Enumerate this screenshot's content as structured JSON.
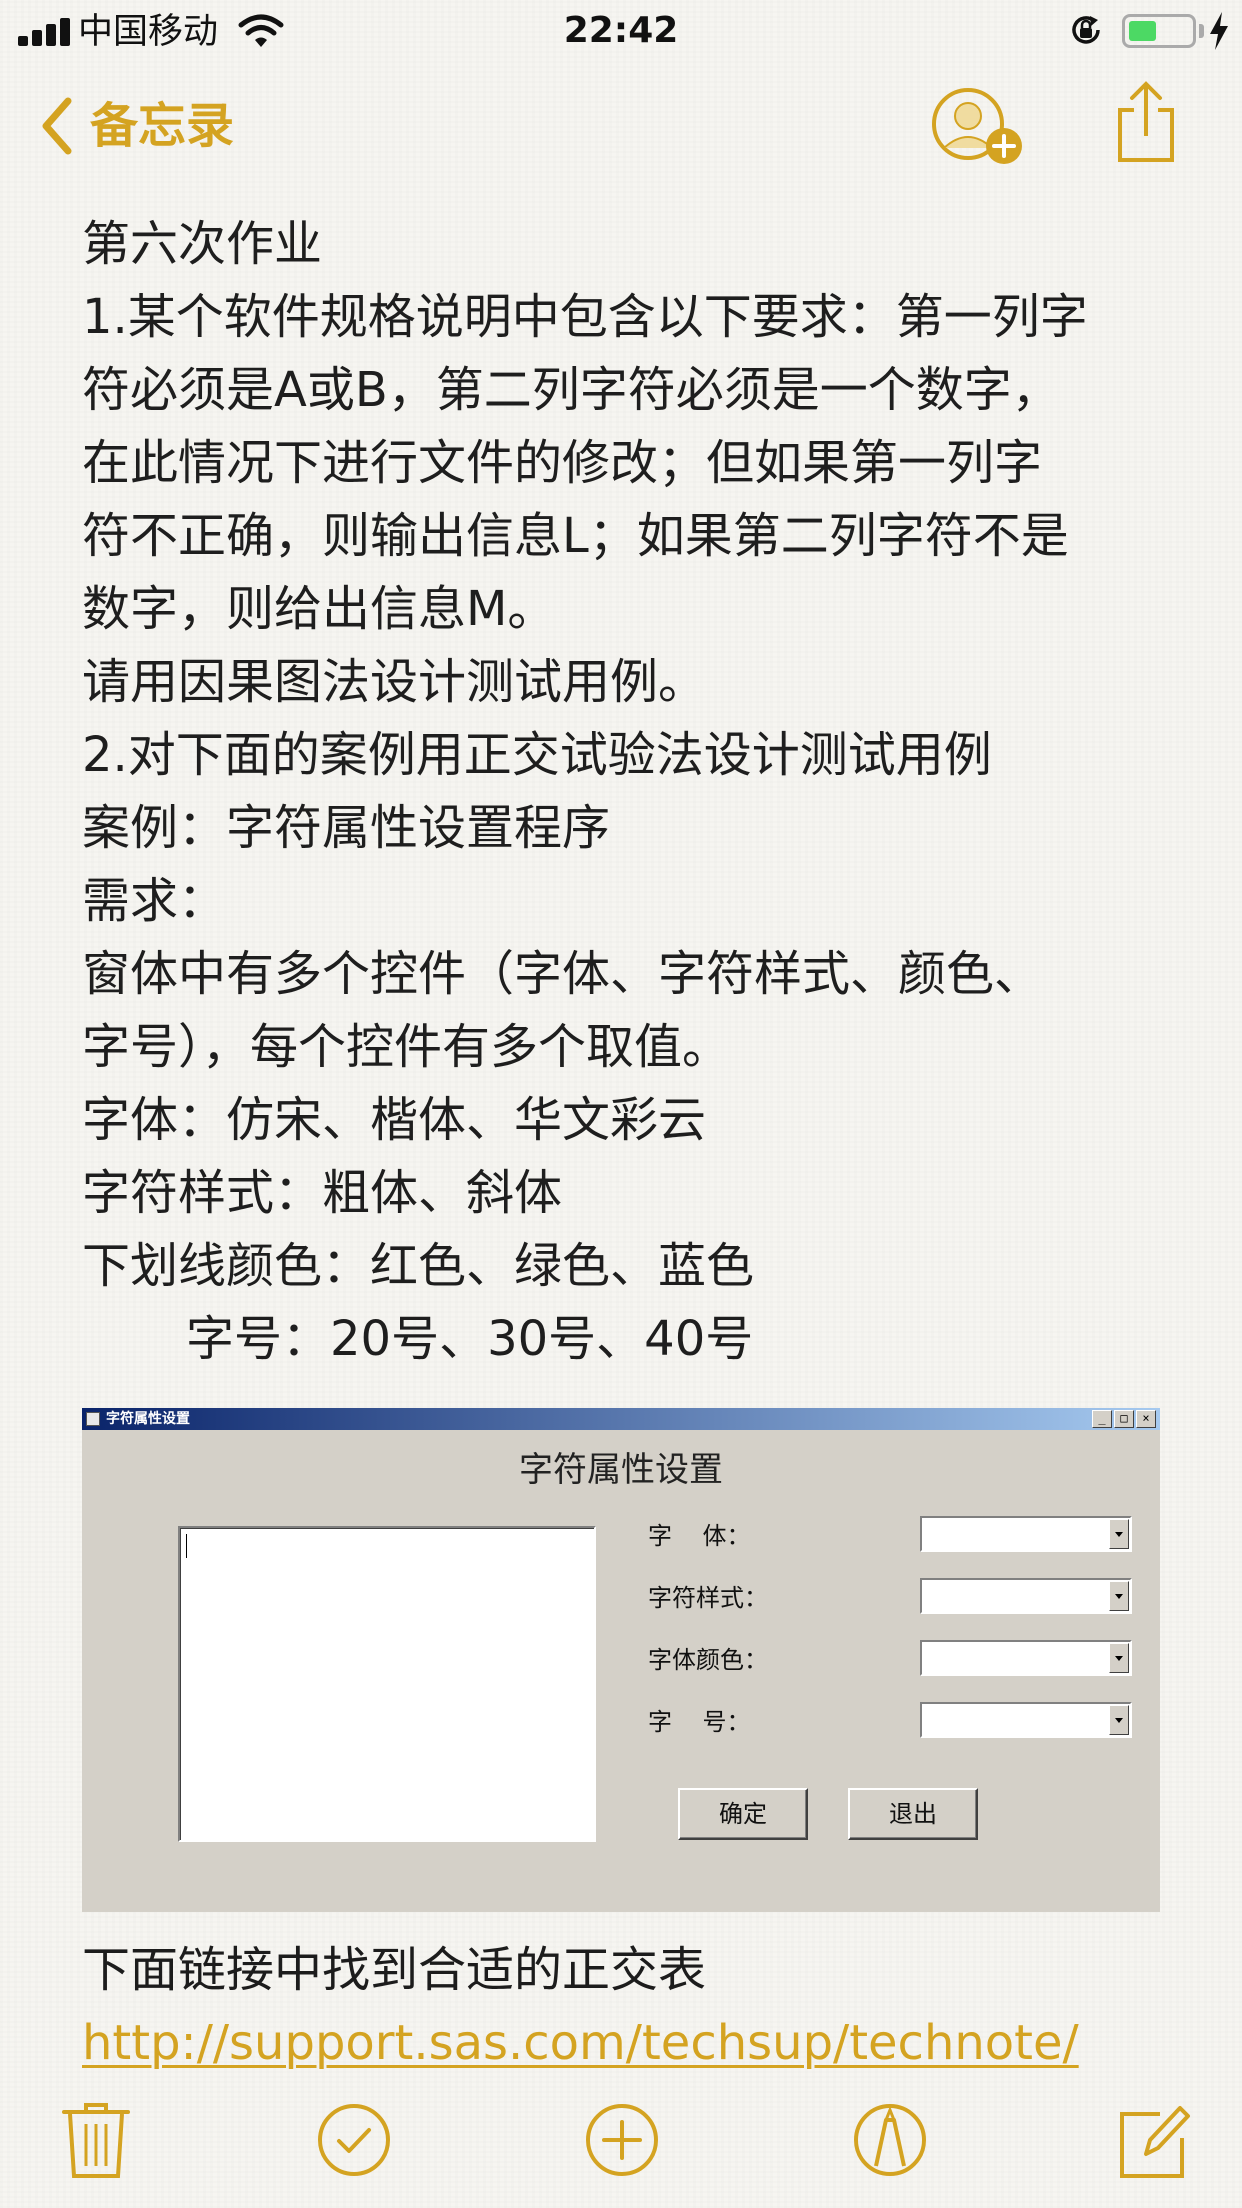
{
  "status_bar": {
    "carrier": "中国移动",
    "time": "22:42",
    "battery_level": 0.45,
    "colors": {
      "battery": "#4cd964"
    }
  },
  "nav": {
    "back_label": "备忘录",
    "icons": [
      "chevron-left-icon",
      "add-person-icon",
      "share-icon"
    ],
    "accent": "#d4a321"
  },
  "note": {
    "lines": [
      "第六次作业",
      "1.某个软件规格说明中包含以下要求：第一列字",
      "符必须是A或B，第二列字符必须是一个数字，",
      "在此情况下进行文件的修改；但如果第一列字",
      "符不正确，则输出信息L；如果第二列字符不是",
      "数字，则给出信息M。",
      "请用因果图法设计测试用例。",
      "2.对下面的案例用正交试验法设计测试用例",
      "案例：字符属性设置程序",
      "需求：",
      "窗体中有多个控件（字体、字符样式、颜色、",
      "字号），每个控件有多个取值。",
      "字体：仿宋、楷体、华文彩云",
      "字符样式：粗体、斜体",
      "下划线颜色：红色、绿色、蓝色",
      "字号：20号、30号、40号"
    ],
    "after_image_text": "下面链接中找到合适的正交表",
    "link_text": "http://support.sas.com/techsup/technote/"
  },
  "dialog": {
    "window_title": "字符属性设置",
    "heading": "字符属性设置",
    "fields": [
      {
        "label": "字    体："
      },
      {
        "label": "字符样式："
      },
      {
        "label": "字体颜色："
      },
      {
        "label": "字    号："
      }
    ],
    "ok_label": "确定",
    "exit_label": "退出",
    "window_buttons": [
      "_",
      "□",
      "×"
    ]
  },
  "toolbar": {
    "icons": [
      "trash-icon",
      "checklist-icon",
      "add-icon",
      "markup-icon",
      "compose-icon"
    ]
  }
}
